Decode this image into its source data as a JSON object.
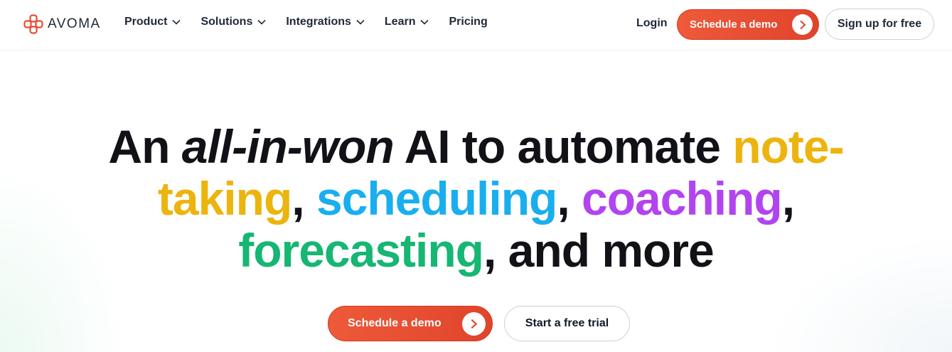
{
  "brand": {
    "name": "AVOMA",
    "logo_icon": "avoma-logo-icon",
    "accent": "#e74c30"
  },
  "nav": {
    "items": [
      {
        "label": "Product",
        "has_dropdown": true
      },
      {
        "label": "Solutions",
        "has_dropdown": true
      },
      {
        "label": "Integrations",
        "has_dropdown": true
      },
      {
        "label": "Learn",
        "has_dropdown": true
      },
      {
        "label": "Pricing",
        "has_dropdown": false
      }
    ],
    "login_label": "Login",
    "demo_label": "Schedule a demo",
    "signup_label": "Sign up for free"
  },
  "hero": {
    "line1_a": "An ",
    "line1_em": "all-in-won",
    "line1_b": " AI to automate ",
    "line1_c": "note-",
    "line2_a": "taking",
    "line2_sep1": ", ",
    "line2_b": "scheduling",
    "line2_sep2": ", ",
    "line2_c": "coaching",
    "line2_sep3": ",",
    "line3_a": "forecasting",
    "line3_b": ", and more",
    "colors": {
      "yellow": "#ecb40e",
      "blue": "#1aaeee",
      "purple": "#b244f0",
      "green": "#16b673"
    },
    "cta_primary": "Schedule a demo",
    "cta_secondary": "Start a free trial"
  }
}
